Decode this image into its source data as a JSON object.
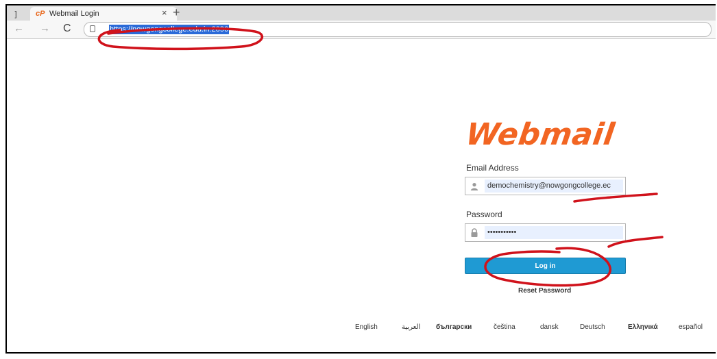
{
  "browser": {
    "tab_stub": "]",
    "tab": {
      "favicon": "cP",
      "title": "Webmail Login",
      "close": "×"
    },
    "new_tab": "+",
    "nav": {
      "back": "←",
      "forward": "→",
      "reload": "C"
    },
    "url": "https://nowgongcollege.edu.in:2096"
  },
  "login": {
    "logo": "Webmail",
    "email_label": "Email Address",
    "email_value": "demochemistry@nowgongcollege.ec",
    "password_label": "Password",
    "password_value": "•••••••••••",
    "login_button": "Log in",
    "reset_link": "Reset Password"
  },
  "languages": [
    "English",
    "العربية",
    "български",
    "čeština",
    "dansk",
    "Deutsch",
    "Ελληνικά",
    "español"
  ],
  "colors": {
    "accent": "#1f9ad3",
    "logo": "#f26522",
    "annotation": "#d0121b"
  }
}
